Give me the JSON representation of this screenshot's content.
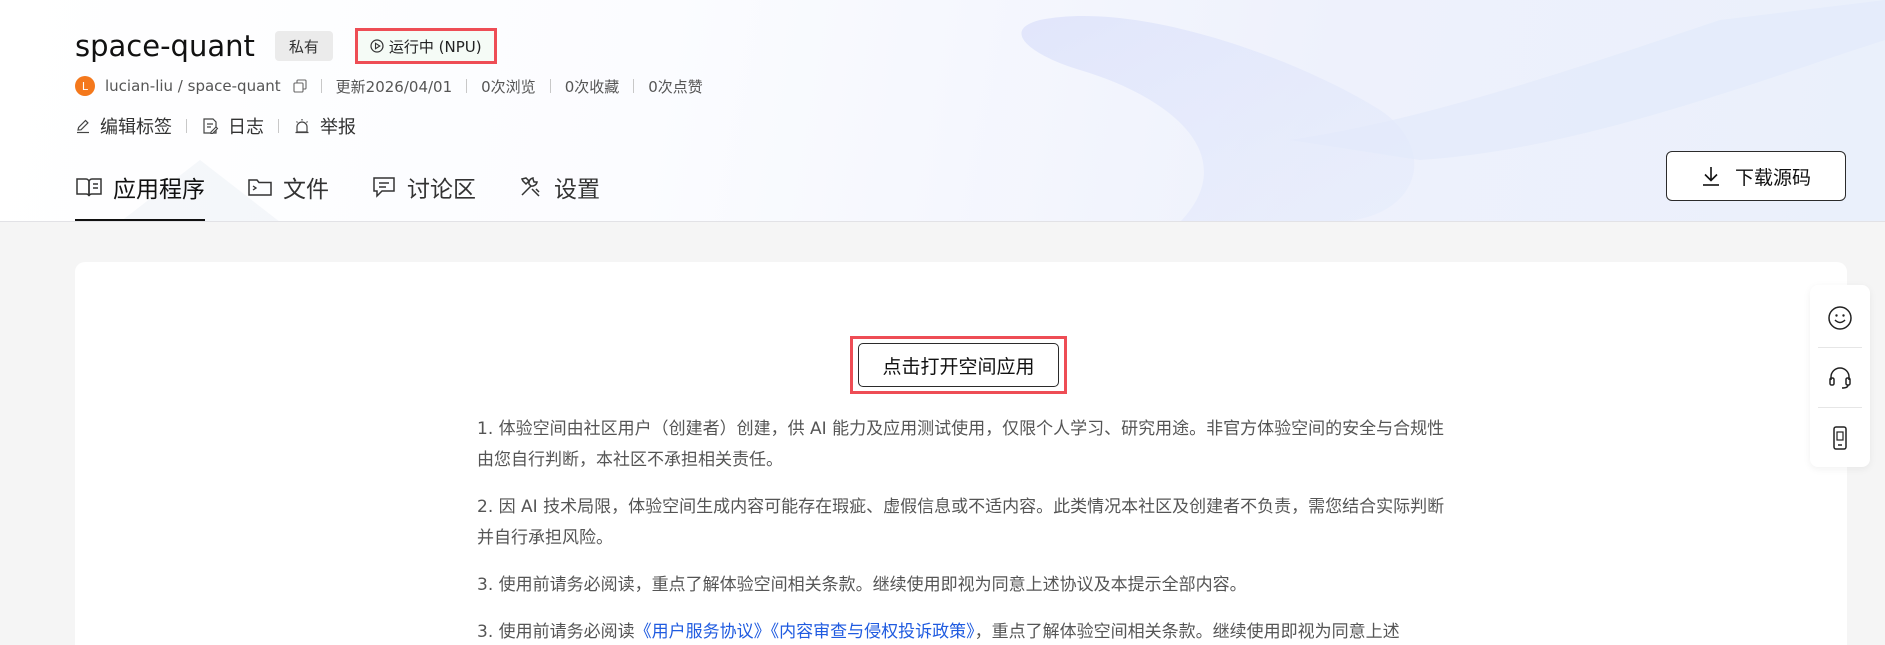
{
  "header": {
    "title": "space-quant",
    "private_badge": "私有",
    "status_badge": "运行中 (NPU)",
    "avatar_letter": "L",
    "owner_path": "lucian-liu / space-quant",
    "updated": "更新2026/04/01",
    "views": "0次浏览",
    "favorites": "0次收藏",
    "likes": "0次点赞",
    "actions": {
      "edit_tags": "编辑标签",
      "log": "日志",
      "report": "举报"
    },
    "download_label": "下载源码"
  },
  "tabs": [
    {
      "label": "应用程序",
      "icon": "book-open-icon",
      "active": true
    },
    {
      "label": "文件",
      "icon": "folder-icon",
      "active": false
    },
    {
      "label": "讨论区",
      "icon": "chat-icon",
      "active": false
    },
    {
      "label": "设置",
      "icon": "tools-icon",
      "active": false
    }
  ],
  "main": {
    "open_button": "点击打开空间应用",
    "notice": [
      "1. 体验空间由社区用户（创建者）创建，供 AI 能力及应用测试使用，仅限个人学习、研究用途。非官方体验空间的安全与合规性由您自行判断，本社区不承担相关责任。",
      "2. 因 AI 技术局限，体验空间生成内容可能存在瑕疵、虚假信息或不适内容。此类情况本社区及创建者不负责，需您结合实际判断并自行承担风险。",
      "3. 使用前请务必阅读，重点了解体验空间相关条款。继续使用即视为同意上述协议及本提示全部内容。"
    ],
    "notice4": {
      "prefix": "3. 使用前请务必阅读",
      "link1": "《用户服务协议》",
      "link2": "《内容审查与侵权投诉政策》",
      "suffix": "，重点了解体验空间相关条款。继续使用即视为同意上述"
    }
  },
  "float_panel": {
    "icons": [
      "smiley-icon",
      "headset-icon",
      "phone-icon"
    ]
  },
  "colors": {
    "highlight_border": "#ee4d55",
    "avatar": "#f4781c",
    "link": "#1f5be0"
  }
}
